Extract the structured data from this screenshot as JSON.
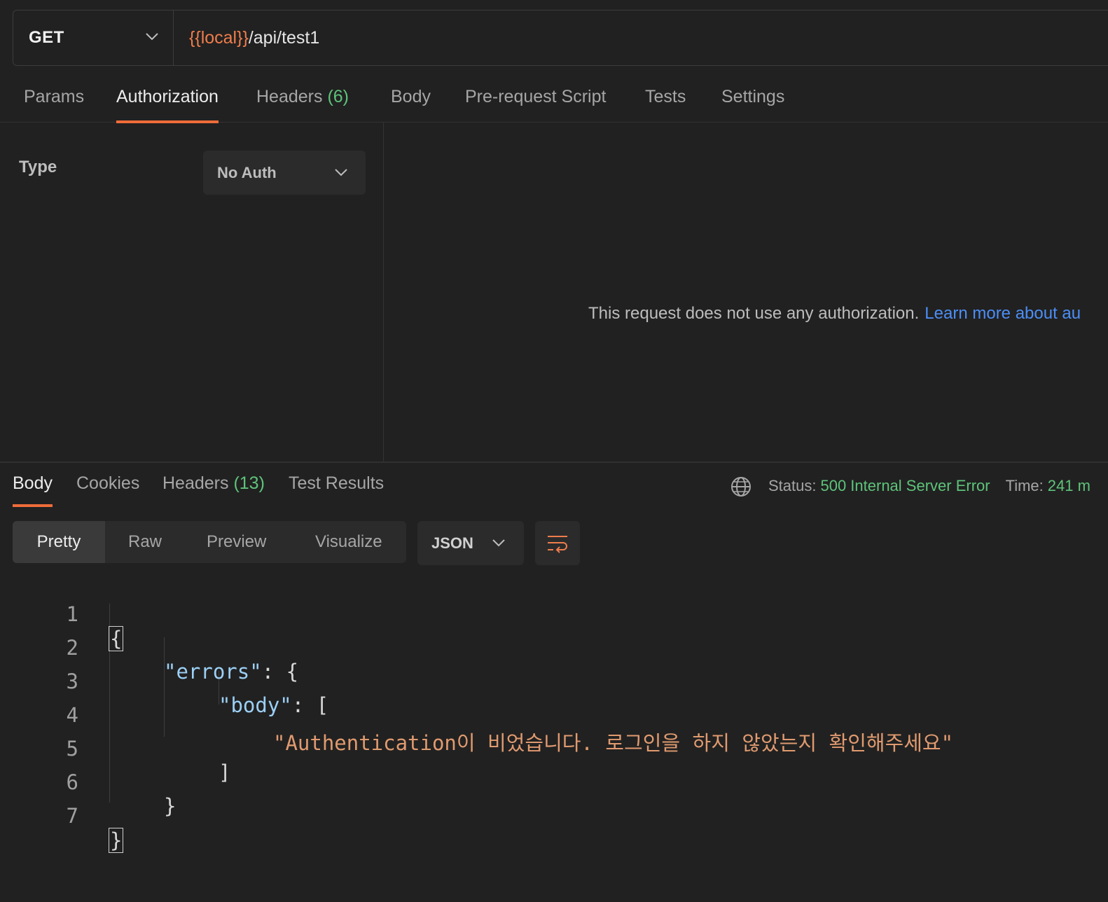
{
  "request": {
    "method": "GET",
    "url_variable": "{{local}}",
    "url_path": "/api/test1"
  },
  "request_tabs": [
    {
      "label": "Params"
    },
    {
      "label": "Authorization",
      "active": true
    },
    {
      "label": "Headers",
      "count": "(6)"
    },
    {
      "label": "Body"
    },
    {
      "label": "Pre-request Script"
    },
    {
      "label": "Tests"
    },
    {
      "label": "Settings"
    }
  ],
  "auth": {
    "type_label": "Type",
    "type_value": "No Auth",
    "message": "This request does not use any authorization.",
    "link_text": "Learn more about au"
  },
  "response_tabs": [
    {
      "label": "Body",
      "active": true
    },
    {
      "label": "Cookies"
    },
    {
      "label": "Headers",
      "count": "(13)"
    },
    {
      "label": "Test Results"
    }
  ],
  "response_meta": {
    "status_label": "Status:",
    "status_value": "500 Internal Server Error",
    "time_label": "Time:",
    "time_value": "241 m"
  },
  "view_modes": [
    "Pretty",
    "Raw",
    "Preview",
    "Visualize"
  ],
  "active_view": "Pretty",
  "format": "JSON",
  "code": {
    "line_numbers": [
      "1",
      "2",
      "3",
      "4",
      "5",
      "6",
      "7"
    ],
    "open_brace": "{",
    "errors_key": "\"errors\"",
    "colon": ": ",
    "errors_open": "{",
    "body_key": "\"body\"",
    "body_open": "[",
    "message": "\"Authentication이 비었습니다. 로그인을 하지 않았는지 확인해주세요\"",
    "body_close": "]",
    "errors_close": "}",
    "close_brace": "}"
  },
  "colors": {
    "accent": "#ef6c3a",
    "status_ok": "#5ec37a",
    "link": "#4c8ef5",
    "url_variable": "#ef7d4b"
  },
  "icons": [
    "chevron-down-icon",
    "globe-icon",
    "wrap-lines-icon"
  ]
}
